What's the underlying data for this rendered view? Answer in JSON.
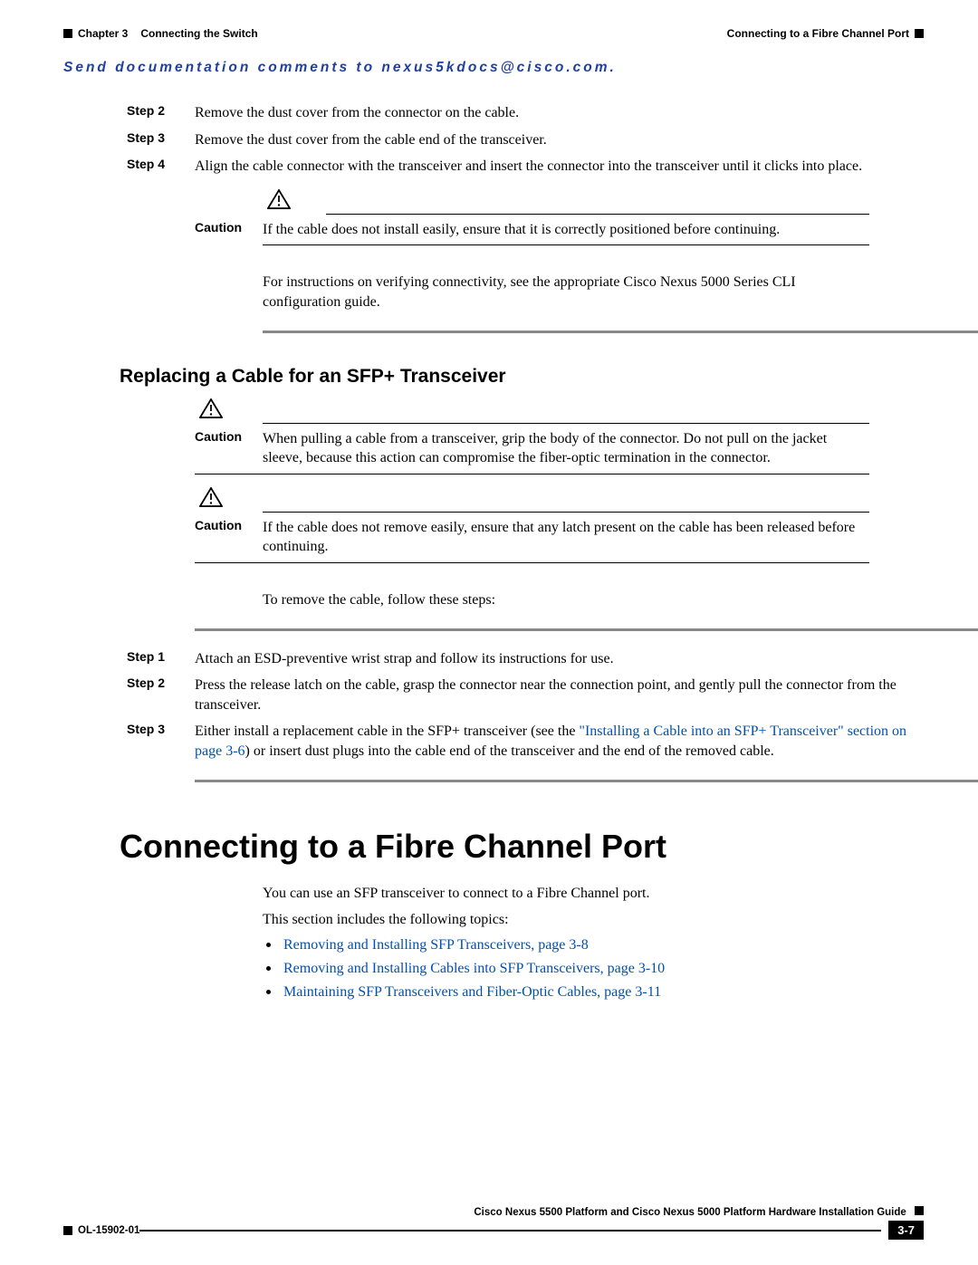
{
  "header": {
    "chapter": "Chapter 3",
    "chapter_title": "Connecting the Switch",
    "section_right": "Connecting to a Fibre Channel Port"
  },
  "send_comments": "Send documentation comments to nexus5kdocs@cisco.com.",
  "steps1": [
    {
      "label": "Step 2",
      "text": "Remove the dust cover from the connector on the cable."
    },
    {
      "label": "Step 3",
      "text": "Remove the dust cover from the cable end of the transceiver."
    },
    {
      "label": "Step 4",
      "text": "Align the cable connector with the transceiver and insert the connector into the transceiver until it clicks into place."
    }
  ],
  "caution1": {
    "label": "Caution",
    "text": "If the cable does not install easily, ensure that it is correctly positioned before continuing."
  },
  "para1": "For instructions on verifying connectivity, see the appropriate Cisco Nexus 5000 Series CLI configuration guide.",
  "h2": "Replacing a Cable for an SFP+ Transceiver",
  "caution2": {
    "label": "Caution",
    "text": "When pulling a cable from a transceiver, grip the body of the connector. Do not pull on the jacket sleeve, because this action can compromise the fiber-optic termination in the connector."
  },
  "caution3": {
    "label": "Caution",
    "text": "If the cable does not remove easily, ensure that any latch present on the cable has been released before continuing."
  },
  "para2": "To remove the cable, follow these steps:",
  "steps2": [
    {
      "label": "Step 1",
      "text": "Attach an ESD-preventive wrist strap and follow its instructions for use."
    },
    {
      "label": "Step 2",
      "text": "Press the release latch on the cable, grasp the connector near the connection point, and gently pull the connector from the transceiver."
    },
    {
      "label": "Step 3",
      "text_before": "Either install a replacement cable in the SFP+ transceiver (see the ",
      "link": "\"Installing a Cable into an SFP+ Transceiver\" section on page 3-6",
      "text_after": ") or insert dust plugs into the cable end of the transceiver and the end of the removed cable."
    }
  ],
  "h1": "Connecting to a Fibre Channel Port",
  "para3": "You can use an SFP transceiver to connect to a Fibre Channel port.",
  "para4": "This section includes the following topics:",
  "bullets": [
    "Removing and Installing SFP Transceivers, page 3-8",
    "Removing and Installing Cables into SFP Transceivers, page 3-10",
    "Maintaining SFP Transceivers and Fiber-Optic Cables, page 3-11"
  ],
  "footer": {
    "title": "Cisco Nexus 5500 Platform and Cisco Nexus 5000 Platform Hardware Installation Guide",
    "doc_id": "OL-15902-01",
    "page_num": "3-7"
  }
}
